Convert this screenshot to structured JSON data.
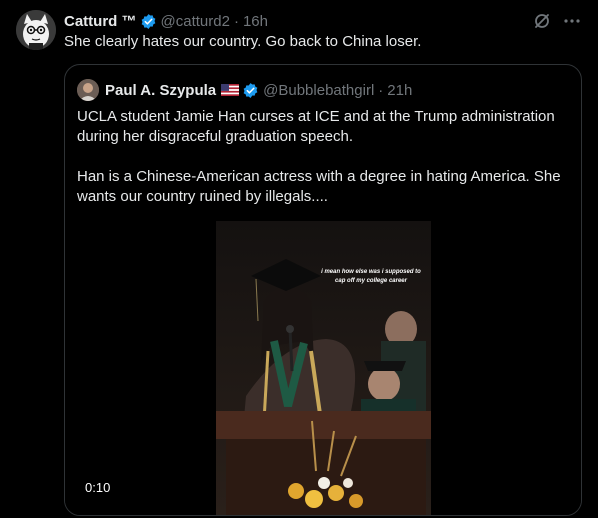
{
  "tweet": {
    "author_name": "Catturd ™",
    "handle": "@catturd2",
    "separator": "·",
    "time": "16h",
    "text": "She clearly hates our country. Go back to China loser.",
    "actions": [
      "grok-icon",
      "more-icon"
    ]
  },
  "quote": {
    "author_name": "Paul A. Szypula",
    "handle": "@Bubblebathgirl",
    "separator": "·",
    "time": "21h",
    "paragraph_1": "UCLA student Jamie Han curses at ICE and at the Trump administration during her disgraceful graduation speech.",
    "paragraph_2": "Han is a Chinese-American actress with a degree in hating America. She wants our country ruined by illegals....",
    "video": {
      "caption": "i mean how else was i supposed to cap off my college career",
      "timestamp": "0:10"
    }
  },
  "colors": {
    "background": "#000000",
    "text": "#e7e9ea",
    "muted": "#71767b",
    "border": "#2f3336",
    "verified": "#1d9bf0"
  }
}
